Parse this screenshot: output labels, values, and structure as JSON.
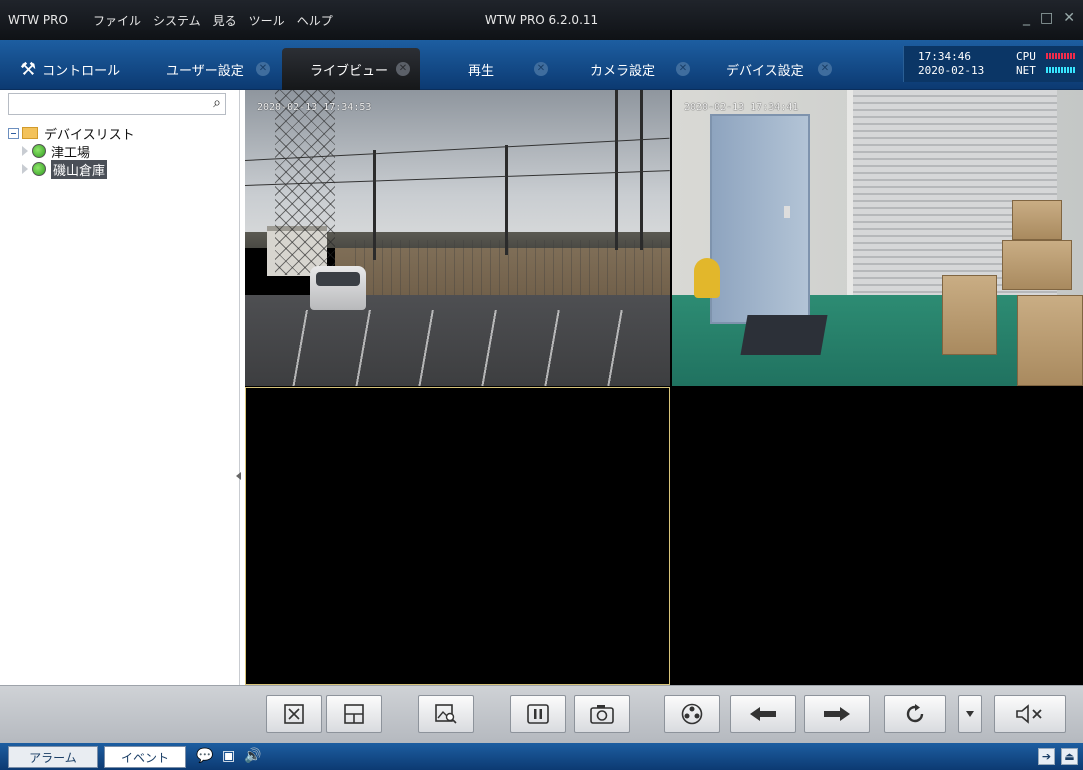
{
  "titlebar": {
    "app_name": "WTW PRO",
    "menus": [
      "ファイル",
      "システム",
      "見る",
      "ツール",
      "ヘルプ"
    ],
    "window_title": "WTW PRO 6.2.0.11"
  },
  "tabs": [
    {
      "label": "コントロール",
      "icon": "tools-icon",
      "closable": false
    },
    {
      "label": "ユーザー設定",
      "closable": true
    },
    {
      "label": "ライブビュー",
      "closable": true,
      "active": true
    },
    {
      "label": "再生",
      "closable": true
    },
    {
      "label": "カメラ設定",
      "closable": true
    },
    {
      "label": "デバイス設定",
      "closable": true
    }
  ],
  "status": {
    "time": "17:34:46",
    "date": "2020-02-13",
    "cpu_label": "CPU",
    "net_label": "NET",
    "cpu_color": "#f02c4b",
    "net_color": "#38e6ff"
  },
  "sidebar": {
    "search_placeholder": "",
    "tree": {
      "root_label": "デバイスリスト",
      "devices": [
        {
          "label": "津工場",
          "selected": false
        },
        {
          "label": "磯山倉庫",
          "selected": true
        }
      ]
    }
  },
  "video": {
    "cells": [
      {
        "timestamp": "2020-02-13 17:34:53",
        "scene": "outdoor-substation"
      },
      {
        "timestamp": "2020-02-13 17:34:41",
        "scene": "warehouse-interior"
      },
      {
        "timestamp": "",
        "scene": "empty",
        "selected": true
      },
      {
        "timestamp": "",
        "scene": "empty"
      }
    ]
  },
  "toolbar": {
    "buttons": [
      "fullscreen-icon",
      "layout-icon",
      "image-search-icon",
      "pause-icon",
      "snapshot-icon",
      "ptz-icon",
      "arrow-left-icon",
      "arrow-right-icon",
      "refresh-icon",
      "dropdown-icon",
      "mute-icon"
    ]
  },
  "statusbar": {
    "alarm_label": "アラーム",
    "event_label": "イベント"
  },
  "colors": {
    "tab_bar": "#1d5ea1",
    "title_bar": "#20242b",
    "selected_cell_border": "#d8c47a"
  }
}
